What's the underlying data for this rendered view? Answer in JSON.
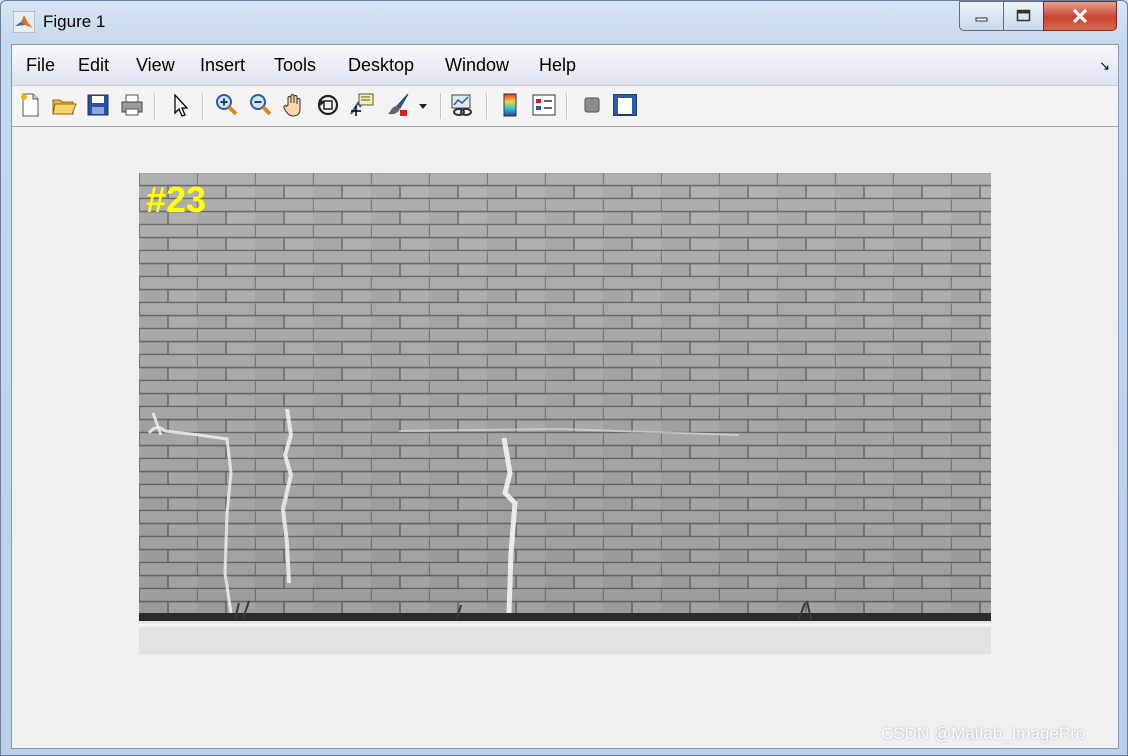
{
  "window": {
    "title": "Figure 1"
  },
  "menubar": {
    "items": [
      "File",
      "Edit",
      "View",
      "Insert",
      "Tools",
      "Desktop",
      "Window",
      "Help"
    ]
  },
  "toolbar": {
    "tools": [
      "new-figure-icon",
      "open-file-icon",
      "save-icon",
      "print-icon",
      "edit-plot-arrow-icon",
      "zoom-in-icon",
      "zoom-out-icon",
      "pan-hand-icon",
      "rotate-3d-icon",
      "data-cursor-icon",
      "brush-icon",
      "link-plot-icon",
      "colorbar-icon",
      "legend-icon",
      "hide-plot-tools-icon",
      "show-plot-tools-icon"
    ]
  },
  "figure": {
    "image_label": "#23",
    "label_color": "#ffff00"
  },
  "watermark": "CSDN @Matlab_ImagePro"
}
